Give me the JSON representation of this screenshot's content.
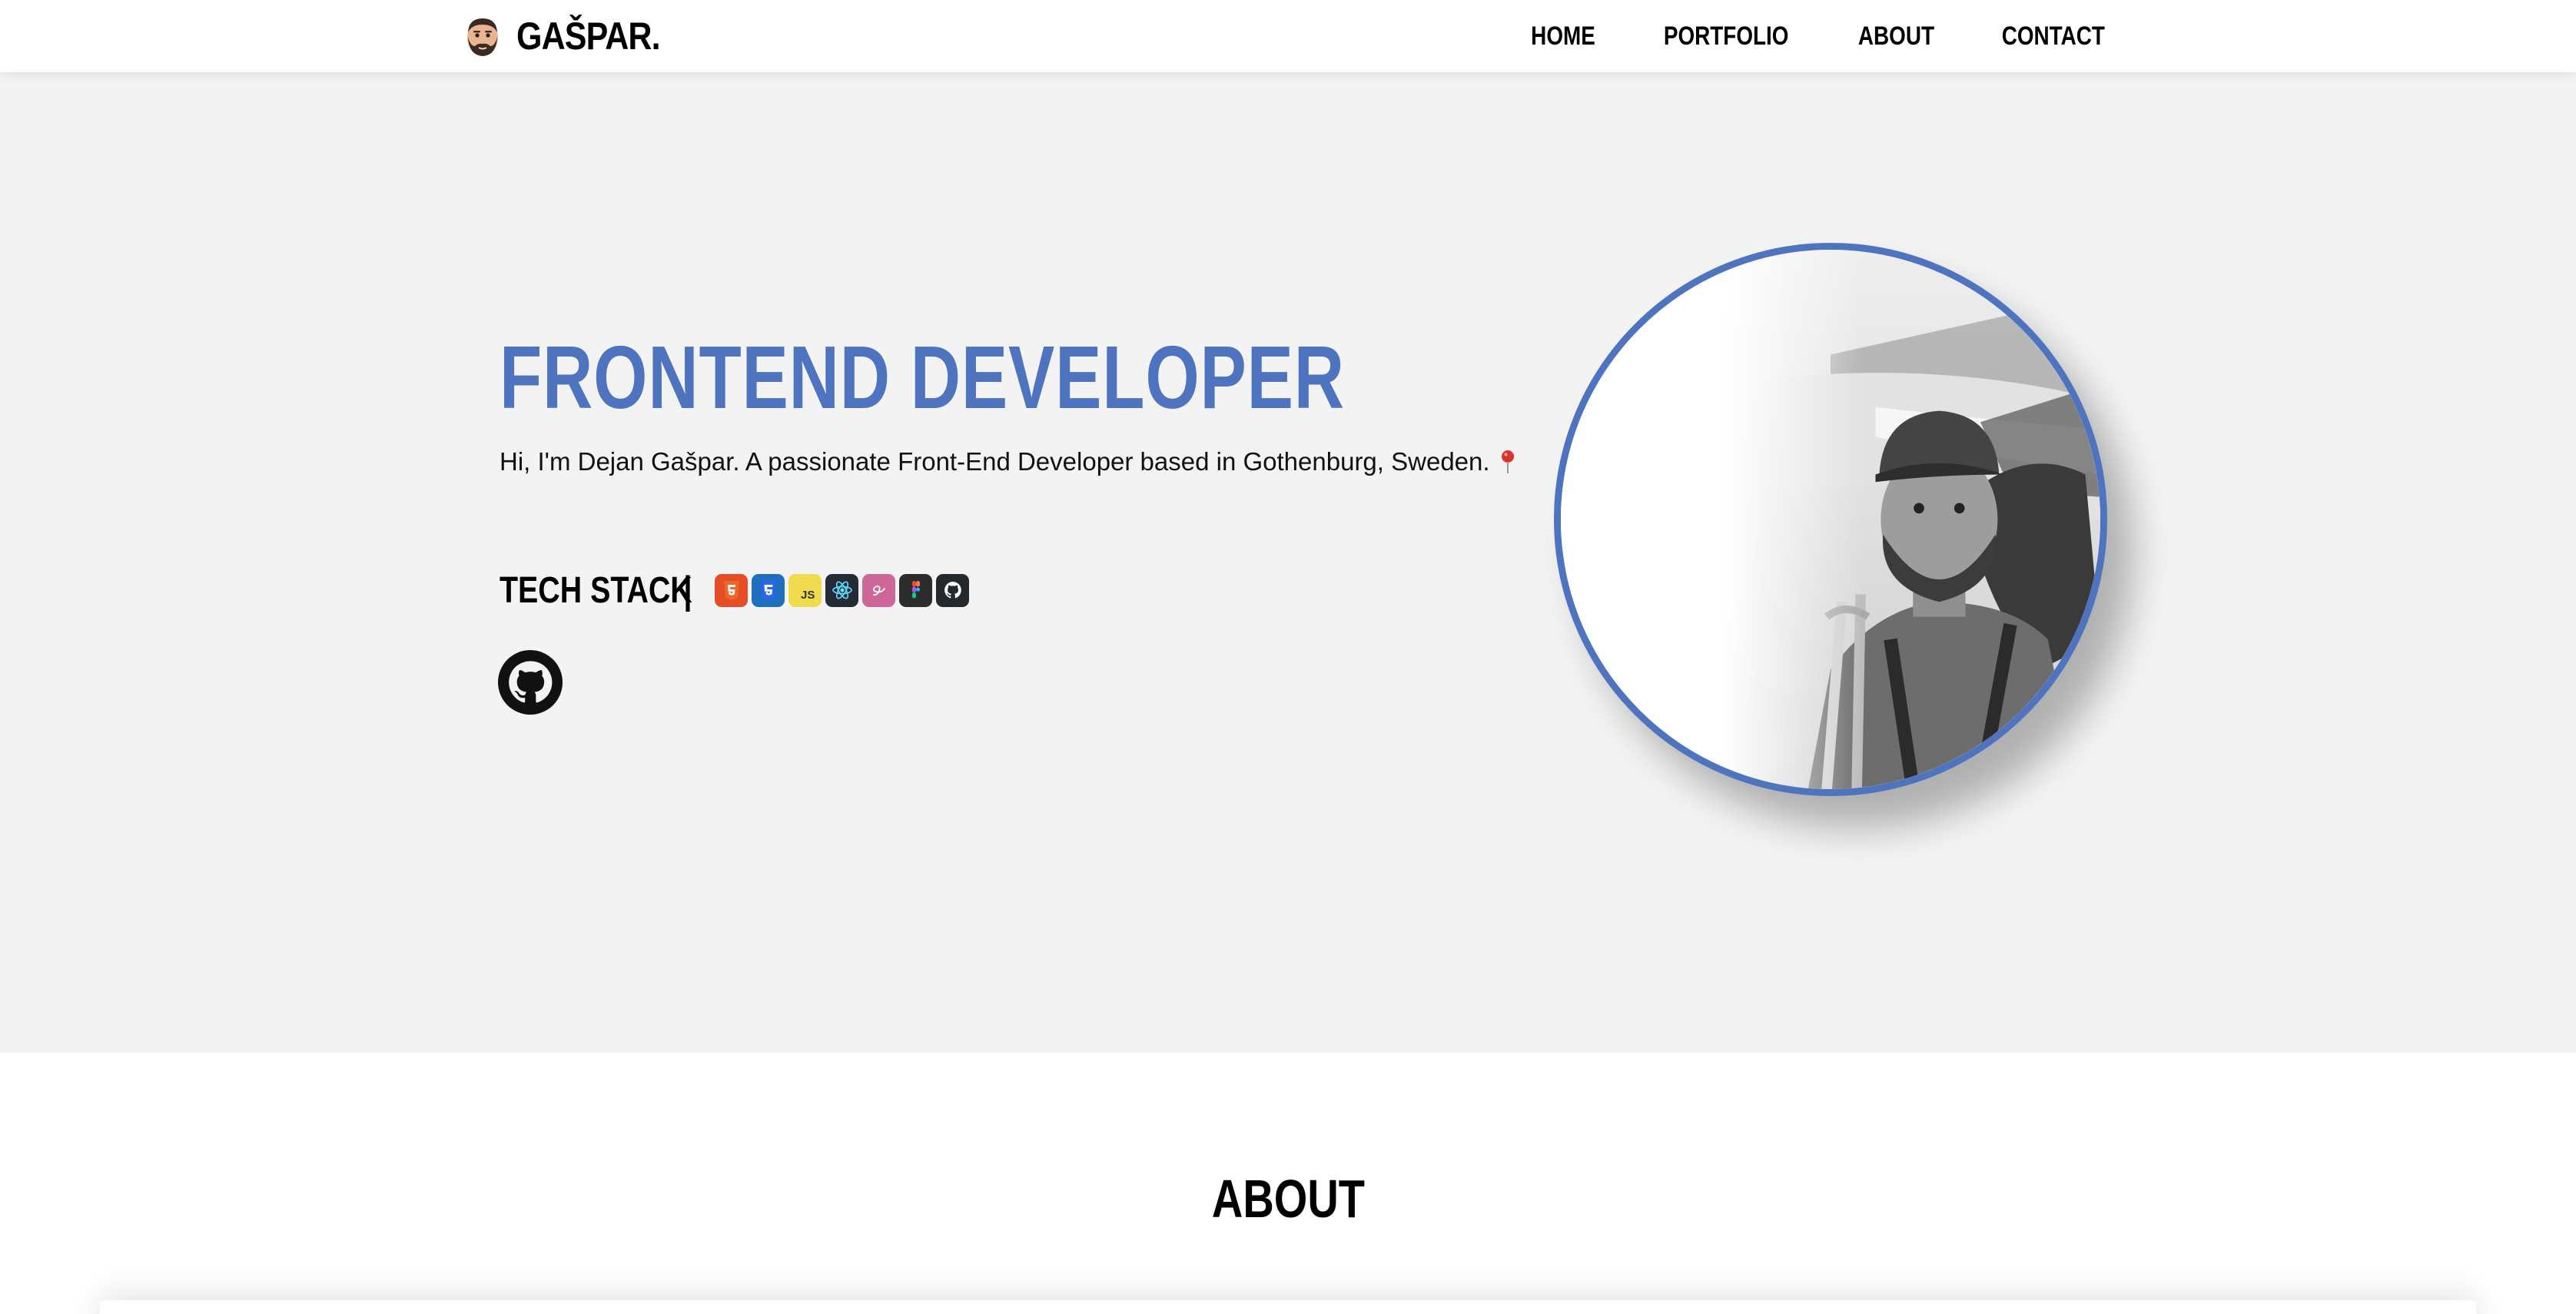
{
  "navbar": {
    "brand_name": "GAŠPAR.",
    "logo_icon": "bearded-man-emoji-icon",
    "links": [
      {
        "label": "HOME"
      },
      {
        "label": "PORTFOLIO"
      },
      {
        "label": "ABOUT"
      },
      {
        "label": "CONTACT"
      }
    ]
  },
  "hero": {
    "title": "FRONTEND DEVELOPER",
    "intro": "Hi, I'm Dejan Gašpar. A passionate Front-End Developer based in Gothenburg, Sweden.",
    "intro_icon": "location-pin-icon",
    "tech_stack": {
      "label": "TECH STACK",
      "separator": "|",
      "icons": [
        "html5-icon",
        "css3-icon",
        "javascript-icon",
        "react-icon",
        "sass-icon",
        "figma-icon",
        "github-icon"
      ],
      "js_label": "JS"
    },
    "github_link_icon": "github-icon",
    "portrait_alt": "portrait-photo"
  },
  "about": {
    "title": "ABOUT"
  },
  "colors": {
    "accent": "#4f74bf",
    "hero_bg": "#f3f3f3",
    "nav_bg": "#ffffff",
    "text": "#000000"
  }
}
